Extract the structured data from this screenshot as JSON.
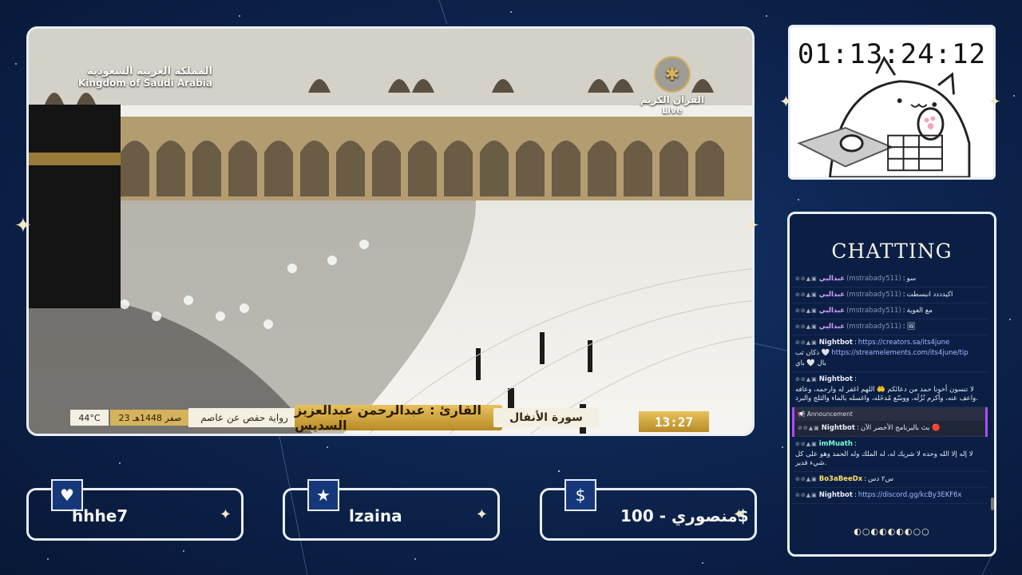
{
  "video": {
    "logo_left_ar": "المملكة العربية السعودية",
    "logo_left_en": "Kingdom of Saudi Arabia",
    "logo_right_line1": "القرآن الكريم",
    "logo_right_line2": "Live",
    "surah": "سورة الأنفال",
    "reader": "القارئ : عبدالرحمن عبدالعزيز السديس",
    "riwaya": "رواية حفص عن عاصم",
    "date": "23 صفر 1448هـ",
    "temperature": "44°C",
    "clock": "13:27"
  },
  "timer": {
    "value": "01:13:24:12"
  },
  "chat": {
    "title": "CHATTING",
    "messages": [
      {
        "user": "عبدالبي",
        "handle": "(mstrabady511)",
        "text": "سو",
        "color": "#d8a0ff"
      },
      {
        "user": "عبدالبي",
        "handle": "(mstrabady511)",
        "text": "اكيدددد انبسطت",
        "color": "#d8a0ff"
      },
      {
        "user": "عبدالبي",
        "handle": "(mstrabady511)",
        "text": "مع العوية",
        "color": "#d8a0ff"
      },
      {
        "user": "عبدالبي",
        "handle": "(mstrabady511)",
        "text": "🖼",
        "color": "#d8a0ff"
      },
      {
        "user": "Nightbot",
        "text": "دكان ثب 🤍",
        "link": "https://creators.sa/its4june",
        "link2": "https://streamelements.com/its4june/tip",
        "text2": "بال 🤍 باي",
        "color": "#fff"
      },
      {
        "user": "Nightbot",
        "text": "لا تنسون أخونا حمد من دعائكم 🤲 اللهم اغفر له وارحمه، وعافه واعف عنه، وأكرم نُزُلَه، ووسّع مُدخَله، واغسله بالماء والثلج والبرد.",
        "color": "#fff"
      },
      {
        "user": "Nightbot",
        "text": "بث بالبرنامج الأخضر الآن 🔴",
        "color": "#fff",
        "announcement": true
      },
      {
        "user": "imMuath",
        "text": "لا إله إلا الله وحده لا شريك له، له الملك وله الحمد وهو على كل شيء قدير.",
        "color": "#7fffd4"
      },
      {
        "user": "Bo3aBeeDx",
        "text": "س٢ دس",
        "color": "#ffe066"
      },
      {
        "user": "Nightbot",
        "link": "https://discord.gg/kcBy3EKF6x",
        "color": "#fff"
      }
    ],
    "announcement_label": "Announcement",
    "moon_phases": "◐○◐◐◐◐◐○○"
  },
  "cards": [
    {
      "icon": "heart-icon",
      "glyph": "♥",
      "name": "hhhe7"
    },
    {
      "icon": "star-icon",
      "glyph": "★",
      "name": "lzaina"
    },
    {
      "icon": "dollar-icon",
      "glyph": "$",
      "name": "منصوري - 100$"
    }
  ],
  "colors": {
    "background": "#0c2147",
    "border": "#e9eef6",
    "gold": "#d6b25a"
  }
}
